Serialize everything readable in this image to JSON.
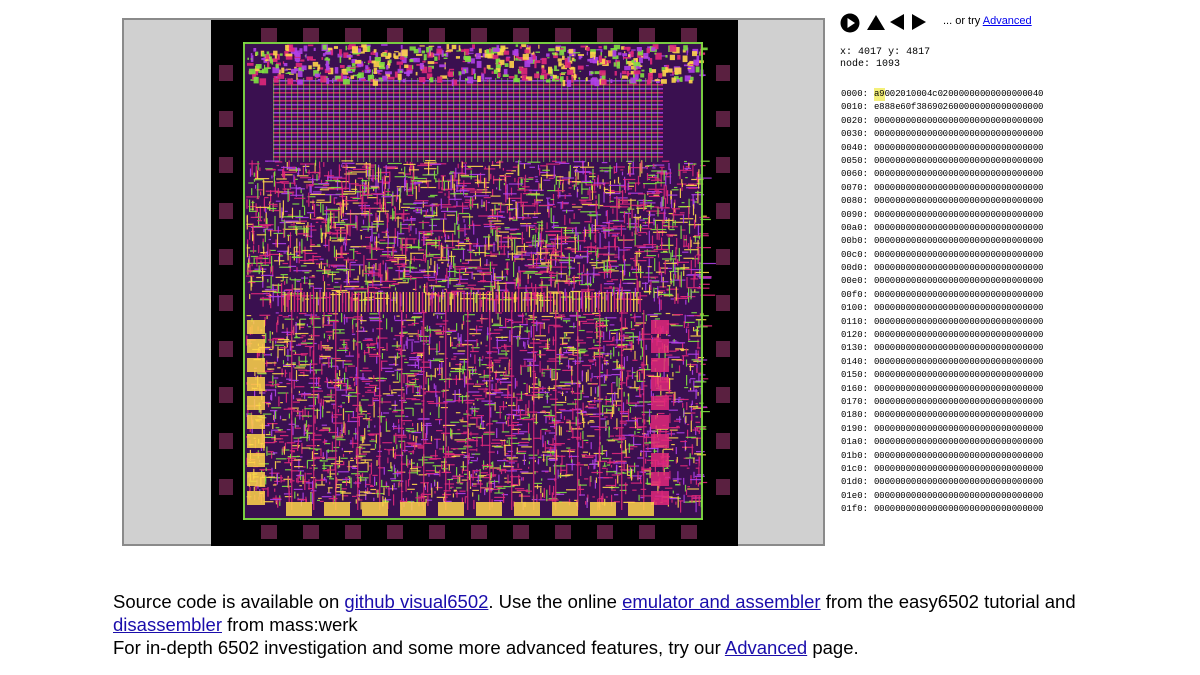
{
  "controls": {
    "play_icon": "play-icon",
    "step_up_icon": "triangle-up-icon",
    "step_back_icon": "triangle-left-icon",
    "step_forward_icon": "triangle-right-icon",
    "or_try_prefix": "... or try",
    "advanced_link": "Advanced"
  },
  "status": {
    "x_label": "x:",
    "x_value": "4017",
    "y_label": "y:",
    "y_value": "4817",
    "node_label": "node:",
    "node_value": "1093"
  },
  "memory": {
    "highlight": "0000:0",
    "rows": [
      {
        "addr": "0000:",
        "bytes": [
          "a9",
          "00",
          "20",
          "10",
          "00",
          "4c",
          "02",
          "00",
          "00",
          "00",
          "00",
          "00",
          "00",
          "00",
          "00",
          "40"
        ]
      },
      {
        "addr": "0010:",
        "bytes": [
          "e8",
          "88",
          "e6",
          "0f",
          "38",
          "69",
          "02",
          "60",
          "00",
          "00",
          "00",
          "00",
          "00",
          "00",
          "00",
          "00"
        ]
      },
      {
        "addr": "0020:",
        "bytes": [
          "00",
          "00",
          "00",
          "00",
          "00",
          "00",
          "00",
          "00",
          "00",
          "00",
          "00",
          "00",
          "00",
          "00",
          "00",
          "00"
        ]
      },
      {
        "addr": "0030:",
        "bytes": [
          "00",
          "00",
          "00",
          "00",
          "00",
          "00",
          "00",
          "00",
          "00",
          "00",
          "00",
          "00",
          "00",
          "00",
          "00",
          "00"
        ]
      },
      {
        "addr": "0040:",
        "bytes": [
          "00",
          "00",
          "00",
          "00",
          "00",
          "00",
          "00",
          "00",
          "00",
          "00",
          "00",
          "00",
          "00",
          "00",
          "00",
          "00"
        ]
      },
      {
        "addr": "0050:",
        "bytes": [
          "00",
          "00",
          "00",
          "00",
          "00",
          "00",
          "00",
          "00",
          "00",
          "00",
          "00",
          "00",
          "00",
          "00",
          "00",
          "00"
        ]
      },
      {
        "addr": "0060:",
        "bytes": [
          "00",
          "00",
          "00",
          "00",
          "00",
          "00",
          "00",
          "00",
          "00",
          "00",
          "00",
          "00",
          "00",
          "00",
          "00",
          "00"
        ]
      },
      {
        "addr": "0070:",
        "bytes": [
          "00",
          "00",
          "00",
          "00",
          "00",
          "00",
          "00",
          "00",
          "00",
          "00",
          "00",
          "00",
          "00",
          "00",
          "00",
          "00"
        ]
      },
      {
        "addr": "0080:",
        "bytes": [
          "00",
          "00",
          "00",
          "00",
          "00",
          "00",
          "00",
          "00",
          "00",
          "00",
          "00",
          "00",
          "00",
          "00",
          "00",
          "00"
        ]
      },
      {
        "addr": "0090:",
        "bytes": [
          "00",
          "00",
          "00",
          "00",
          "00",
          "00",
          "00",
          "00",
          "00",
          "00",
          "00",
          "00",
          "00",
          "00",
          "00",
          "00"
        ]
      },
      {
        "addr": "00a0:",
        "bytes": [
          "00",
          "00",
          "00",
          "00",
          "00",
          "00",
          "00",
          "00",
          "00",
          "00",
          "00",
          "00",
          "00",
          "00",
          "00",
          "00"
        ]
      },
      {
        "addr": "00b0:",
        "bytes": [
          "00",
          "00",
          "00",
          "00",
          "00",
          "00",
          "00",
          "00",
          "00",
          "00",
          "00",
          "00",
          "00",
          "00",
          "00",
          "00"
        ]
      },
      {
        "addr": "00c0:",
        "bytes": [
          "00",
          "00",
          "00",
          "00",
          "00",
          "00",
          "00",
          "00",
          "00",
          "00",
          "00",
          "00",
          "00",
          "00",
          "00",
          "00"
        ]
      },
      {
        "addr": "00d0:",
        "bytes": [
          "00",
          "00",
          "00",
          "00",
          "00",
          "00",
          "00",
          "00",
          "00",
          "00",
          "00",
          "00",
          "00",
          "00",
          "00",
          "00"
        ]
      },
      {
        "addr": "00e0:",
        "bytes": [
          "00",
          "00",
          "00",
          "00",
          "00",
          "00",
          "00",
          "00",
          "00",
          "00",
          "00",
          "00",
          "00",
          "00",
          "00",
          "00"
        ]
      },
      {
        "addr": "00f0:",
        "bytes": [
          "00",
          "00",
          "00",
          "00",
          "00",
          "00",
          "00",
          "00",
          "00",
          "00",
          "00",
          "00",
          "00",
          "00",
          "00",
          "00"
        ]
      },
      {
        "addr": "0100:",
        "bytes": [
          "00",
          "00",
          "00",
          "00",
          "00",
          "00",
          "00",
          "00",
          "00",
          "00",
          "00",
          "00",
          "00",
          "00",
          "00",
          "00"
        ]
      },
      {
        "addr": "0110:",
        "bytes": [
          "00",
          "00",
          "00",
          "00",
          "00",
          "00",
          "00",
          "00",
          "00",
          "00",
          "00",
          "00",
          "00",
          "00",
          "00",
          "00"
        ]
      },
      {
        "addr": "0120:",
        "bytes": [
          "00",
          "00",
          "00",
          "00",
          "00",
          "00",
          "00",
          "00",
          "00",
          "00",
          "00",
          "00",
          "00",
          "00",
          "00",
          "00"
        ]
      },
      {
        "addr": "0130:",
        "bytes": [
          "00",
          "00",
          "00",
          "00",
          "00",
          "00",
          "00",
          "00",
          "00",
          "00",
          "00",
          "00",
          "00",
          "00",
          "00",
          "00"
        ]
      },
      {
        "addr": "0140:",
        "bytes": [
          "00",
          "00",
          "00",
          "00",
          "00",
          "00",
          "00",
          "00",
          "00",
          "00",
          "00",
          "00",
          "00",
          "00",
          "00",
          "00"
        ]
      },
      {
        "addr": "0150:",
        "bytes": [
          "00",
          "00",
          "00",
          "00",
          "00",
          "00",
          "00",
          "00",
          "00",
          "00",
          "00",
          "00",
          "00",
          "00",
          "00",
          "00"
        ]
      },
      {
        "addr": "0160:",
        "bytes": [
          "00",
          "00",
          "00",
          "00",
          "00",
          "00",
          "00",
          "00",
          "00",
          "00",
          "00",
          "00",
          "00",
          "00",
          "00",
          "00"
        ]
      },
      {
        "addr": "0170:",
        "bytes": [
          "00",
          "00",
          "00",
          "00",
          "00",
          "00",
          "00",
          "00",
          "00",
          "00",
          "00",
          "00",
          "00",
          "00",
          "00",
          "00"
        ]
      },
      {
        "addr": "0180:",
        "bytes": [
          "00",
          "00",
          "00",
          "00",
          "00",
          "00",
          "00",
          "00",
          "00",
          "00",
          "00",
          "00",
          "00",
          "00",
          "00",
          "00"
        ]
      },
      {
        "addr": "0190:",
        "bytes": [
          "00",
          "00",
          "00",
          "00",
          "00",
          "00",
          "00",
          "00",
          "00",
          "00",
          "00",
          "00",
          "00",
          "00",
          "00",
          "00"
        ]
      },
      {
        "addr": "01a0:",
        "bytes": [
          "00",
          "00",
          "00",
          "00",
          "00",
          "00",
          "00",
          "00",
          "00",
          "00",
          "00",
          "00",
          "00",
          "00",
          "00",
          "00"
        ]
      },
      {
        "addr": "01b0:",
        "bytes": [
          "00",
          "00",
          "00",
          "00",
          "00",
          "00",
          "00",
          "00",
          "00",
          "00",
          "00",
          "00",
          "00",
          "00",
          "00",
          "00"
        ]
      },
      {
        "addr": "01c0:",
        "bytes": [
          "00",
          "00",
          "00",
          "00",
          "00",
          "00",
          "00",
          "00",
          "00",
          "00",
          "00",
          "00",
          "00",
          "00",
          "00",
          "00"
        ]
      },
      {
        "addr": "01d0:",
        "bytes": [
          "00",
          "00",
          "00",
          "00",
          "00",
          "00",
          "00",
          "00",
          "00",
          "00",
          "00",
          "00",
          "00",
          "00",
          "00",
          "00"
        ]
      },
      {
        "addr": "01e0:",
        "bytes": [
          "00",
          "00",
          "00",
          "00",
          "00",
          "00",
          "00",
          "00",
          "00",
          "00",
          "00",
          "00",
          "00",
          "00",
          "00",
          "00"
        ]
      },
      {
        "addr": "01f0:",
        "bytes": [
          "00",
          "00",
          "00",
          "00",
          "00",
          "00",
          "00",
          "00",
          "00",
          "00",
          "00",
          "00",
          "00",
          "00",
          "00",
          "00"
        ]
      }
    ]
  },
  "footer": {
    "t1": "Source code is available on ",
    "link_github": "github visual6502",
    "t2": ". Use the online ",
    "link_emulator": "emulator and assembler",
    "t3": " from the easy6502 tutorial and ",
    "link_disassembler": "disassembler",
    "t4": " from mass:werk",
    "t5": "For in-depth 6502 investigation and some more advanced features, try our ",
    "link_advanced": "Advanced",
    "t6": " page."
  },
  "colors": {
    "metal": "#e0287a",
    "diffusion": "#ffd54a",
    "poly": "#7fe040",
    "via": "#b040e8",
    "pad": "#5a2040",
    "background": "#000000",
    "frame": "#d0d0d0",
    "highlight": "#f4f07a",
    "link": "#1a0dab"
  }
}
